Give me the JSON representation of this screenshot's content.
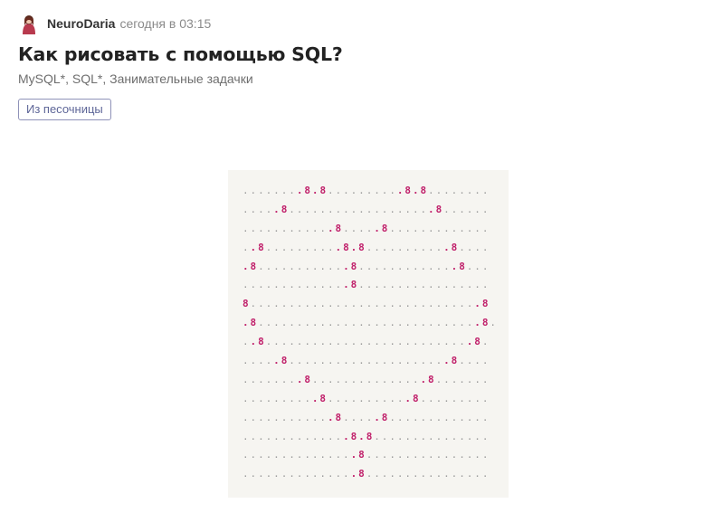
{
  "post": {
    "author": "NeuroDaria",
    "time": "сегодня в 03:15",
    "title": "Как рисовать с помощью SQL?",
    "hubs": [
      "MySQL*",
      "SQL*",
      "Занимательные задачки"
    ],
    "hub_separator": ", ",
    "sandbox_label": "Из песочницы"
  },
  "artwork": {
    "lines": [
      "........8.8..........8.8........",
      ".....8...................8......",
      "............8.....8.............",
      "..8..........8.8...........8....",
      ".8............8.............8...",
      "..............8.................",
      "8..............................8",
      ".8.............................8.",
      "..8...........................8.",
      ".....8.....................8....",
      "........8...............8.......",
      "..........8...........8.........",
      "............8.....8.............",
      "..............8.8...............",
      "...............8................",
      "...............8................"
    ],
    "dot_color": "#9a9a9a",
    "highlight_color": "#c01f6a",
    "background": "#f6f5f1"
  },
  "colors": {
    "author": "#333333",
    "time": "#8a8a8a",
    "title": "#222222",
    "hubs": "#6e6e6e",
    "sandbox_border": "#8f92b8",
    "sandbox_text": "#5e6698"
  }
}
